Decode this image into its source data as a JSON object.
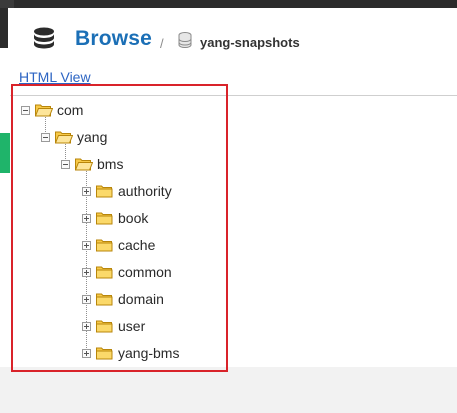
{
  "header": {
    "title": "Browse",
    "separator": "/",
    "repository": "yang-snapshots"
  },
  "view_link": "HTML View",
  "tree": {
    "nodes": [
      {
        "label": "com",
        "icon": "folder-open-icon",
        "expander": "expanded"
      },
      {
        "label": "yang",
        "icon": "folder-open-icon",
        "expander": "expanded"
      },
      {
        "label": "bms",
        "icon": "folder-open-icon",
        "expander": "expanded"
      },
      {
        "label": "authority",
        "icon": "folder-closed-icon",
        "expander": "collapsed"
      },
      {
        "label": "book",
        "icon": "folder-closed-icon",
        "expander": "collapsed"
      },
      {
        "label": "cache",
        "icon": "folder-closed-icon",
        "expander": "collapsed"
      },
      {
        "label": "common",
        "icon": "folder-closed-icon",
        "expander": "collapsed"
      },
      {
        "label": "domain",
        "icon": "folder-closed-icon",
        "expander": "collapsed"
      },
      {
        "label": "user",
        "icon": "folder-closed-icon",
        "expander": "collapsed"
      },
      {
        "label": "yang-bms",
        "icon": "folder-closed-icon",
        "expander": "collapsed"
      }
    ]
  },
  "colors": {
    "accent_blue": "#1b6fb6",
    "link_blue": "#2c64c3",
    "highlight_red": "#d9232a",
    "folder_yellow": "#f7c948",
    "topbar_dark": "#2b2b2b",
    "green_tab": "#1fb46a"
  }
}
